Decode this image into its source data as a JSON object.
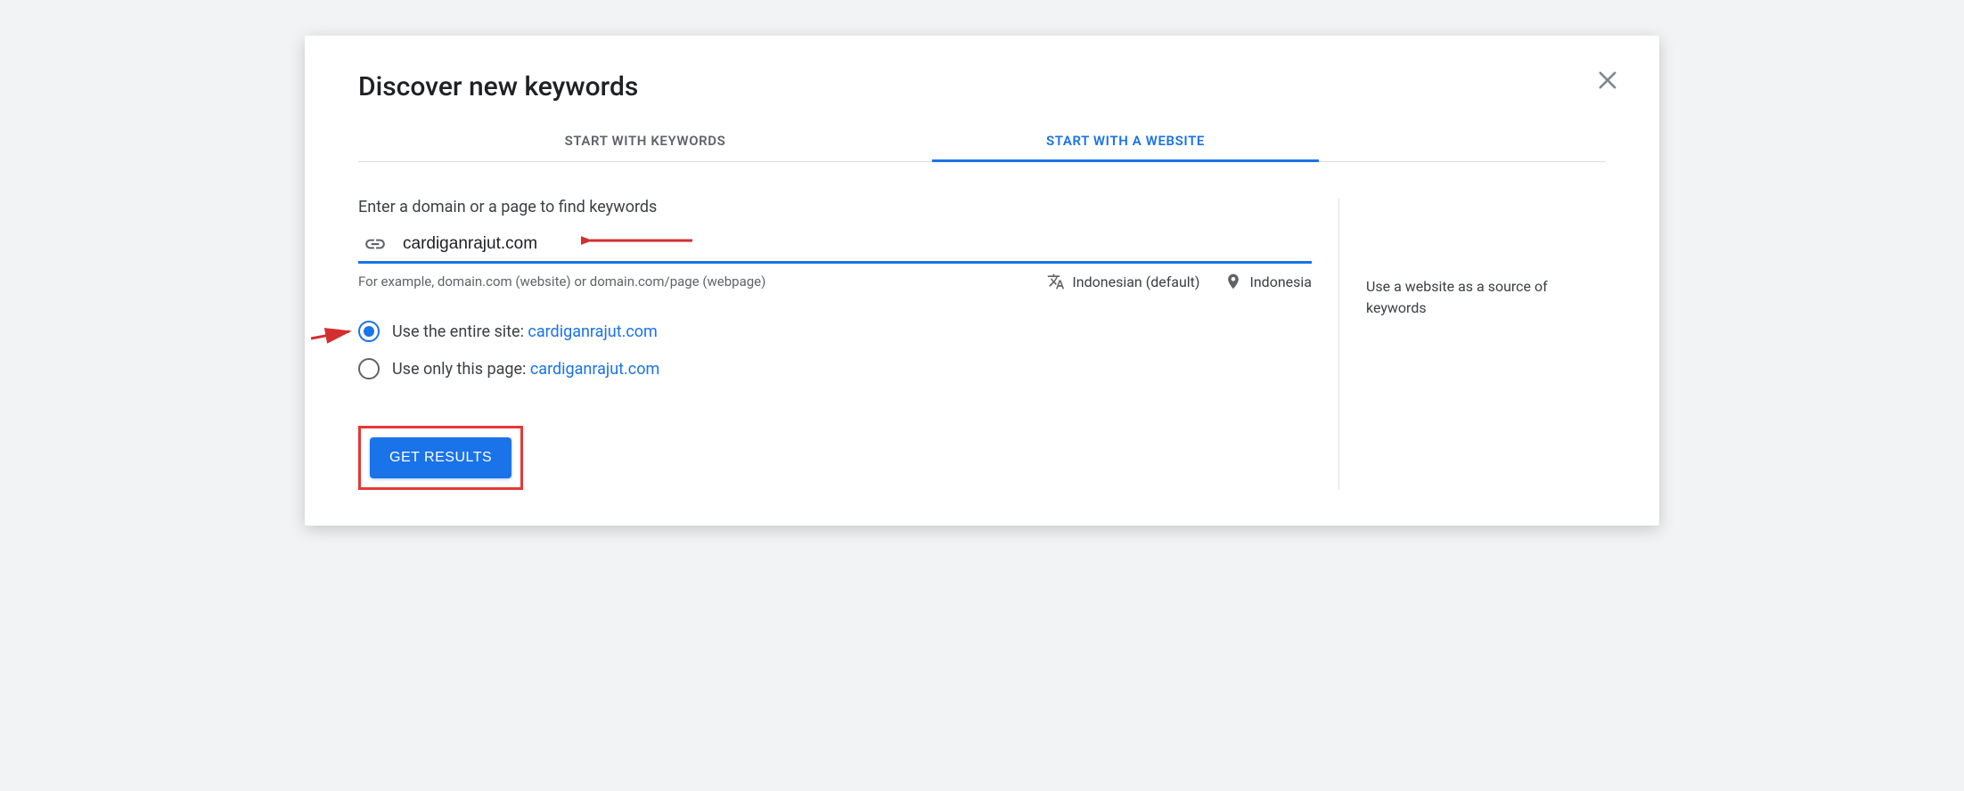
{
  "title": "Discover new keywords",
  "tabs": {
    "keywords": "START WITH KEYWORDS",
    "website": "START WITH A WEBSITE"
  },
  "form": {
    "label": "Enter a domain or a page to find keywords",
    "url_value": "cardiganrajut.com",
    "hint": "For example, domain.com (website) or domain.com/page (webpage)",
    "language": "Indonesian (default)",
    "location": "Indonesia"
  },
  "radios": {
    "entire_prefix": "Use the entire site: ",
    "entire_site": "cardiganrajut.com",
    "page_prefix": "Use only this page: ",
    "page_site": "cardiganrajut.com"
  },
  "button": {
    "get_results": "GET RESULTS"
  },
  "side": {
    "text": "Use a website as a source of keywords"
  }
}
